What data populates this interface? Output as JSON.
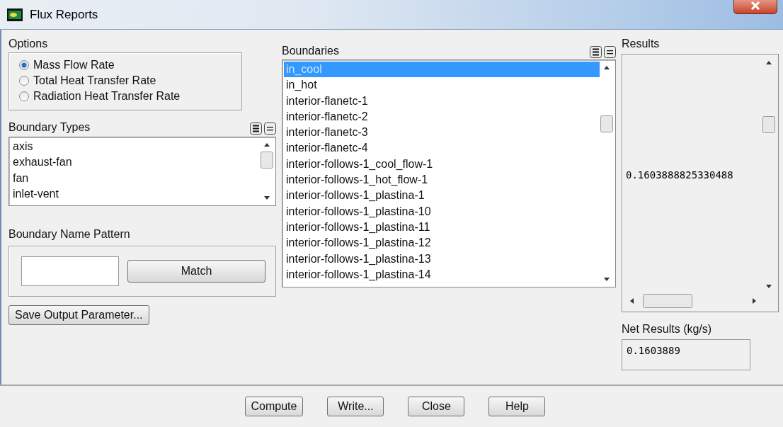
{
  "window": {
    "title": "Flux Reports"
  },
  "options": {
    "label": "Options",
    "items": [
      {
        "label": "Mass Flow Rate",
        "selected": true
      },
      {
        "label": "Total Heat Transfer Rate",
        "selected": false
      },
      {
        "label": "Radiation Heat Transfer Rate",
        "selected": false
      }
    ]
  },
  "boundary_types": {
    "label": "Boundary Types",
    "items": [
      {
        "label": "axis",
        "selected": false
      },
      {
        "label": "exhaust-fan",
        "selected": false
      },
      {
        "label": "fan",
        "selected": false
      },
      {
        "label": "inlet-vent",
        "selected": false
      }
    ]
  },
  "name_pattern": {
    "label": "Boundary Name Pattern",
    "match_button": "Match"
  },
  "save_button": "Save Output Parameter...",
  "boundaries": {
    "label": "Boundaries",
    "items": [
      {
        "label": "in_cool",
        "selected": true
      },
      {
        "label": "in_hot",
        "selected": false
      },
      {
        "label": "interior-flanetc-1",
        "selected": false
      },
      {
        "label": "interior-flanetc-2",
        "selected": false
      },
      {
        "label": "interior-flanetc-3",
        "selected": false
      },
      {
        "label": "interior-flanetc-4",
        "selected": false
      },
      {
        "label": "interior-follows-1_cool_flow-1",
        "selected": false
      },
      {
        "label": "interior-follows-1_hot_flow-1",
        "selected": false
      },
      {
        "label": "interior-follows-1_plastina-1",
        "selected": false
      },
      {
        "label": "interior-follows-1_plastina-10",
        "selected": false
      },
      {
        "label": "interior-follows-1_plastina-11",
        "selected": false
      },
      {
        "label": "interior-follows-1_plastina-12",
        "selected": false
      },
      {
        "label": "interior-follows-1_plastina-13",
        "selected": false
      },
      {
        "label": "interior-follows-1_plastina-14",
        "selected": false
      }
    ]
  },
  "results": {
    "label": "Results",
    "value": "0.1603888825330488"
  },
  "net_results": {
    "label": "Net Results (kg/s)",
    "value": "0.1603889"
  },
  "buttons": [
    "Compute",
    "Write...",
    "Close",
    "Help"
  ]
}
